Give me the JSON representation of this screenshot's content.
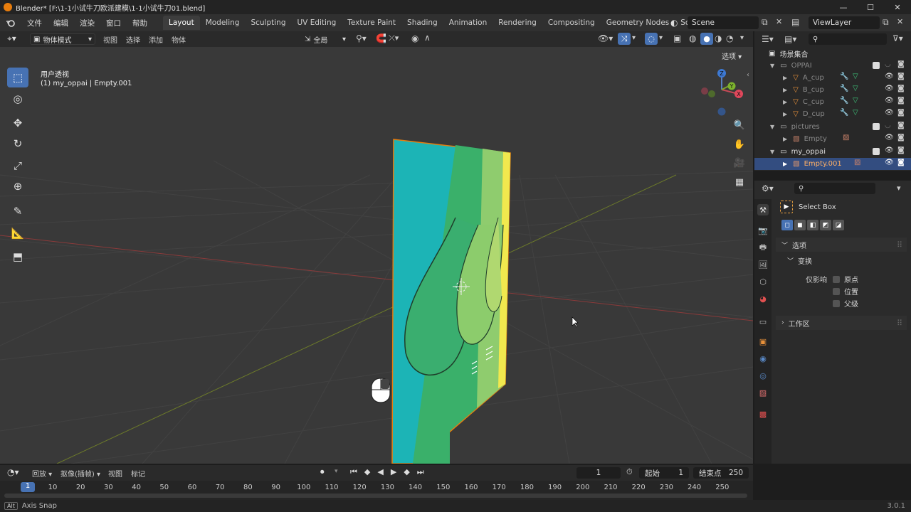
{
  "window": {
    "title": "Blender* [F:\\1-1小试牛刀欧派建模\\1-1小试牛刀01.blend]",
    "minimize": "—",
    "maximize": "☐",
    "close": "✕"
  },
  "menu": [
    "文件",
    "编辑",
    "渲染",
    "窗口",
    "帮助"
  ],
  "workspaces": [
    "Layout",
    "Modeling",
    "Sculpting",
    "UV Editing",
    "Texture Paint",
    "Shading",
    "Animation",
    "Rendering",
    "Compositing",
    "Geometry Nodes",
    "Scripting"
  ],
  "workspace_add": "+",
  "scene": {
    "name": "Scene",
    "view_layer": "ViewLayer"
  },
  "viewport_header": {
    "mode": "物体模式",
    "menus": [
      "视图",
      "选择",
      "添加",
      "物体"
    ],
    "transform_orientation": "全局",
    "options_label": "选项"
  },
  "viewport": {
    "view_name": "用户透视",
    "object_info": "(1) my_oppai | Empty.001"
  },
  "gizmo": {
    "z": "Z",
    "y": "Y",
    "x": "X"
  },
  "outliner": {
    "root": "场景集合",
    "rows": [
      {
        "name": "OPPAI"
      },
      {
        "name": "A_cup"
      },
      {
        "name": "B_cup"
      },
      {
        "name": "C_cup"
      },
      {
        "name": "D_cup"
      },
      {
        "name": "pictures"
      },
      {
        "name": "Empty"
      },
      {
        "name": "my_oppai"
      },
      {
        "name": "Empty.001"
      }
    ]
  },
  "properties": {
    "tool_name": "Select Box",
    "options_panel": "选项",
    "transform_panel": "变换",
    "affect_only": "仅影响",
    "checkboxes": [
      "原点",
      "位置",
      "父级"
    ],
    "workspace_panel": "工作区"
  },
  "timeline": {
    "menus": [
      "回放",
      "抠像(插帧)",
      "视图",
      "标记"
    ],
    "current_frame": "1",
    "start_label": "起始",
    "start": "1",
    "end_label": "结束点",
    "end": "250"
  },
  "ruler": {
    "current": "1",
    "ticks": [
      "10",
      "20",
      "30",
      "40",
      "50",
      "60",
      "70",
      "80",
      "90",
      "100",
      "110",
      "120",
      "130",
      "140",
      "150",
      "160",
      "170",
      "180",
      "190",
      "200",
      "210",
      "220",
      "230",
      "240",
      "250"
    ]
  },
  "status": {
    "key": "Alt",
    "message": "Axis Snap",
    "version": "3.0.1"
  },
  "colors": {
    "accent": "#4772b3",
    "selected_row": "#334d80",
    "orange": "#e87d0d",
    "plane_teal": "#1cb4b6",
    "plane_green": "#3ab06a",
    "plane_yellow": "#f1e84e"
  }
}
